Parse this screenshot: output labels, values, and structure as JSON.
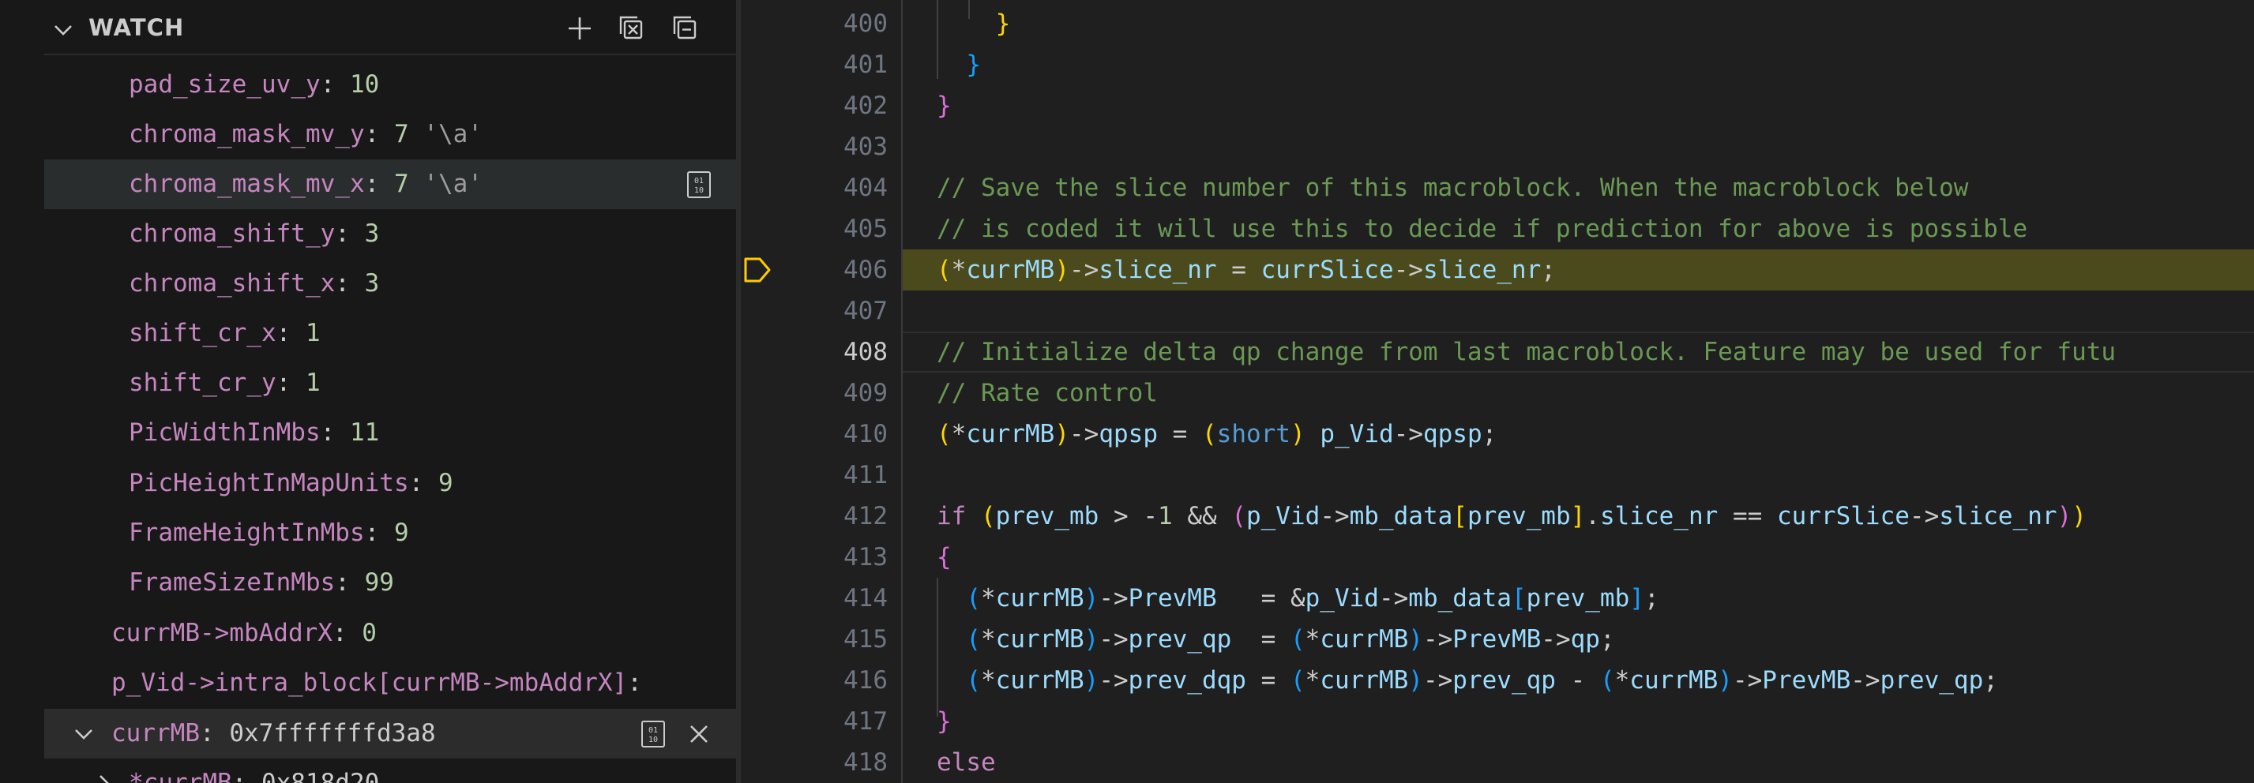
{
  "watch": {
    "title": "WATCH",
    "items": [
      {
        "name": "pad_size_uv_y",
        "value": "10"
      },
      {
        "name": "chroma_mask_mv_y",
        "num": "7",
        "str": "'\\a'"
      },
      {
        "name": "chroma_mask_mv_x",
        "num": "7",
        "str": "'\\a'"
      },
      {
        "name": "chroma_shift_y",
        "value": "3"
      },
      {
        "name": "chroma_shift_x",
        "value": "3"
      },
      {
        "name": "shift_cr_x",
        "value": "1"
      },
      {
        "name": "shift_cr_y",
        "value": "1"
      },
      {
        "name": "PicWidthInMbs",
        "value": "11"
      },
      {
        "name": "PicHeightInMapUnits",
        "value": "9"
      },
      {
        "name": "FrameHeightInMbs",
        "value": "9"
      },
      {
        "name": "FrameSizeInMbs",
        "value": "99"
      }
    ],
    "expr_addr": {
      "name": "currMB->mbAddrX",
      "value": "0"
    },
    "expr_intra": {
      "name": "p_Vid->intra_block[currMB->mbAddrX]"
    },
    "expr_currmb": {
      "name": "currMB",
      "value": "0x7fffffffd3a8"
    },
    "expr_child": {
      "name": "*currMB",
      "value": "0x818d20"
    }
  },
  "editor": {
    "line_numbers": [
      "400",
      "401",
      "402",
      "403",
      "404",
      "405",
      "406",
      "407",
      "408",
      "409",
      "410",
      "411",
      "412",
      "413",
      "414",
      "415",
      "416",
      "417",
      "418"
    ],
    "comment_404": "// Save the slice number of this macroblock. When the macroblock below",
    "comment_405": "// is coded it will use this to decide if prediction for above is possible",
    "comment_408": "// Initialize delta qp change from last macroblock. Feature may be used for futu",
    "comment_409": "// Rate control"
  }
}
